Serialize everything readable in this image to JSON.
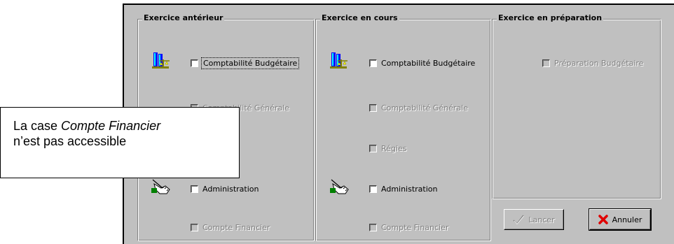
{
  "panels": {
    "anterieur": {
      "title": "Exercice antérieur",
      "budgetaire": "Comptabilité Budgétaire",
      "generale": "Comptabilité Générale",
      "administration": "Administration",
      "compte_financier": "Compte Financier"
    },
    "en_cours": {
      "title": "Exercice en cours",
      "budgetaire": "Comptabilité Budgétaire",
      "generale": "Comptabilité Générale",
      "regies": "Régies",
      "administration": "Administration",
      "compte_financier": "Compte Financier"
    },
    "preparation": {
      "title": "Exercice en préparation",
      "budgetaire": "Préparation Budgétaire"
    }
  },
  "buttons": {
    "lancer": "Lancer",
    "annuler": "Annuler"
  },
  "callout": {
    "prefix": "La case ",
    "emphasis": "Compte Financier",
    "line2": "n’est pas accessible"
  },
  "icons": {
    "budget": "building-scale-icon",
    "admin": "pointing-hand-icon",
    "lancer": "checkmark-icon",
    "annuler": "red-x-icon"
  }
}
